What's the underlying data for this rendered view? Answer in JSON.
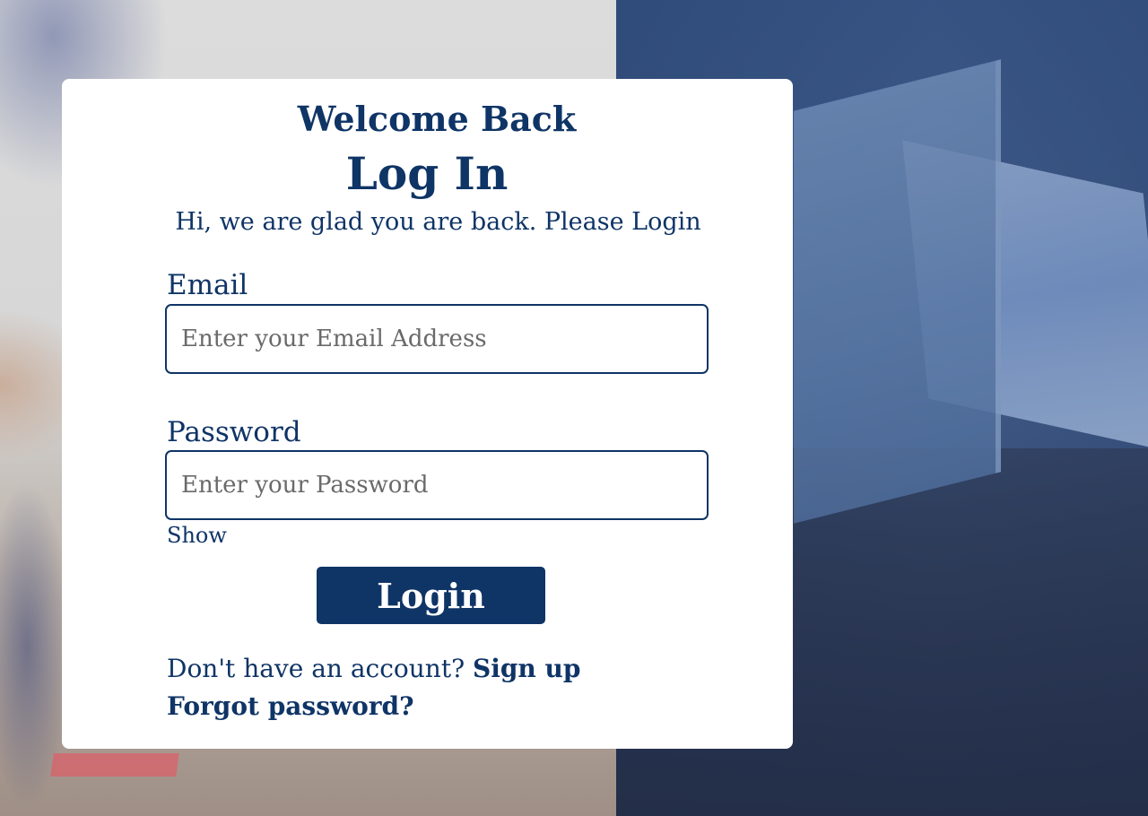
{
  "colors": {
    "brand": "#0f3466",
    "card_background": "#ffffff",
    "button_text": "#ffffff"
  },
  "login_card": {
    "subtitle": "Welcome Back",
    "title": "Log In",
    "tagline": "Hi, we are glad you are back. Please Login",
    "email": {
      "label": "Email",
      "placeholder": "Enter your Email Address",
      "value": ""
    },
    "password": {
      "label": "Password",
      "placeholder": "Enter your Password",
      "value": "",
      "show_label": "Show"
    },
    "login_button_label": "Login",
    "signup_prompt": "Don't have an account? ",
    "signup_link": "Sign up",
    "forgot_link": "Forgot password?"
  }
}
